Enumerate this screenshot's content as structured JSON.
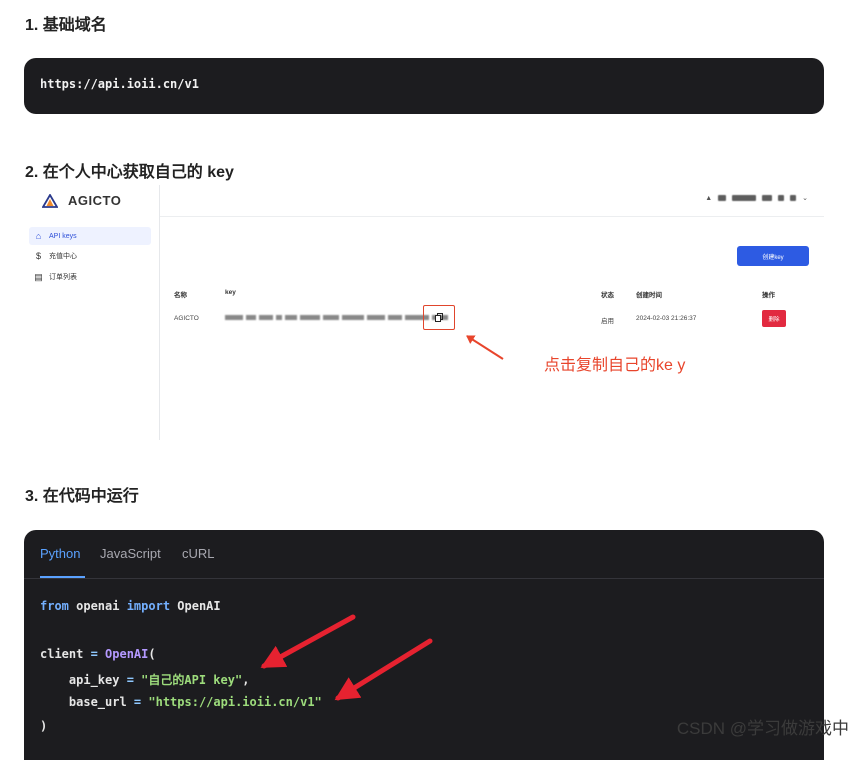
{
  "section1": {
    "heading": "1. 基础域名",
    "code": "https://api.ioii.cn/v1"
  },
  "section2": {
    "heading": "2. 在个人中心获取自己的 key",
    "screenshot": {
      "brand": "AGICTO",
      "nav": [
        "API keys",
        "充值中心",
        "订单列表"
      ],
      "create_button": "创建key",
      "table_headers": {
        "name": "名称",
        "key": "key",
        "status": "状态",
        "created": "创建时间",
        "action": "操作"
      },
      "row": {
        "name": "AGICTO",
        "status": "启用",
        "created": "2024-02-03 21:26:37",
        "delete": "删除"
      }
    },
    "annotation": "点击复制自己的ke y",
    "annotation_color": "#e8452c"
  },
  "section3": {
    "heading": "3. 在代码中运行",
    "tabs": [
      "Python",
      "JavaScript",
      "cURL"
    ],
    "active_tab": "Python",
    "code": {
      "l1_kw1": "from",
      "l1_mod": " openai ",
      "l1_kw2": "import",
      "l1_name": " OpenAI",
      "l2_var": "client ",
      "l2_eq": "=",
      "l2_fn": " OpenAI",
      "l2_paren": "(",
      "l3_key": "    api_key ",
      "l3_eq": "=",
      "l3_val": " \"自己的API key\"",
      "l3_comma": ",",
      "l4_key": "    base_url ",
      "l4_eq": "=",
      "l4_val": " \"https://api.ioii.cn/v1\"",
      "l5": ")"
    }
  },
  "watermark": "CSDN @学习做游戏中",
  "colors": {
    "code_bg": "#1c1c1f",
    "accent": "#5aa1ff",
    "arrow": "#e62230",
    "primary_button": "#2d5be3",
    "danger_button": "#e22a40"
  }
}
